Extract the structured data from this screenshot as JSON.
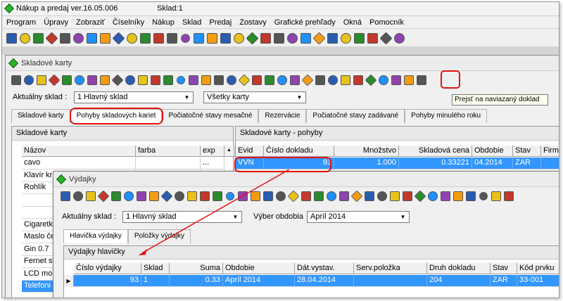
{
  "app": {
    "title": "Nákup a predaj ver.16.05.006",
    "sklad": "Sklad:1"
  },
  "menu": [
    "Program",
    "Úpravy",
    "Zobraziť",
    "Číselníky",
    "Nákup",
    "Sklad",
    "Predaj",
    "Zostavy",
    "Grafické prehľady",
    "Okná",
    "Pomocník"
  ],
  "skladove_karty": {
    "title": "Skladové karty",
    "tooltip": "Prejsť na naviazaný doklad",
    "aktualny_sklad_label": "Aktuálny sklad :",
    "aktualny_sklad_value": "1     Hlavný sklad",
    "karty_filter": "Všetky karty",
    "tabs": [
      "Skladové karty",
      "Pohyby skladových kariet",
      "Počiatočné stavy mesačné",
      "Rezervácie",
      "Počiatočné stavy zadávané",
      "Pohyby minulého roku"
    ],
    "left_panel": {
      "header": "Skladové karty",
      "columns": [
        "Názov",
        "farba",
        "exp"
      ],
      "rows": [
        [
          "cavo",
          "",
          "..."
        ],
        [
          "Klavír kri",
          "",
          ""
        ],
        [
          "Rohlík",
          "",
          ""
        ],
        [
          "",
          "",
          ""
        ],
        [
          "",
          "",
          ""
        ],
        [
          "Cigaretk",
          "",
          ""
        ],
        [
          "Maslo če",
          "",
          ""
        ],
        [
          "Gin 0.7",
          "",
          ""
        ],
        [
          "Fernet st",
          "",
          ""
        ],
        [
          "LCD mo",
          "",
          ""
        ],
        [
          "Telefoni",
          "",
          ""
        ]
      ]
    },
    "right_panel": {
      "header": "Skladové karty - pohyby",
      "columns": [
        "Evid",
        "Číslo dokladu",
        "Množstvo",
        "Skladová cena",
        "Obdobie",
        "Stav",
        "Firm"
      ],
      "rows": [
        [
          "VVN",
          "93",
          "1.000",
          "0.33221",
          "04.2014",
          "ZAR",
          ""
        ]
      ]
    }
  },
  "vydajky": {
    "title": "Výdajky",
    "aktualny_sklad_label": "Aktuálny sklad :",
    "aktualny_sklad_value": "1     Hlavný sklad",
    "vyber_obdobia_label": "Výber obdobia",
    "vyber_obdobia_value": "Apríl 2014",
    "tabs": [
      "Hlavička výdajky",
      "Položky výdajky"
    ],
    "section_header": "Výdajky hlavičky",
    "columns": [
      "Číslo výdajky",
      "Sklad",
      "Suma",
      "Obdobie",
      "Dát.vystav.",
      "Serv.položka",
      "Druh dokladu",
      "Stav",
      "Kód prvku"
    ],
    "rows": [
      [
        "93",
        "1",
        "0.33",
        "Apríl 2014",
        "28.04.2014",
        "",
        "204",
        "ZAR",
        "33-001"
      ]
    ]
  },
  "colors": {
    "highlight": "#e21212",
    "selection": "#3296ff",
    "window_bg": "#f0f0f0"
  }
}
